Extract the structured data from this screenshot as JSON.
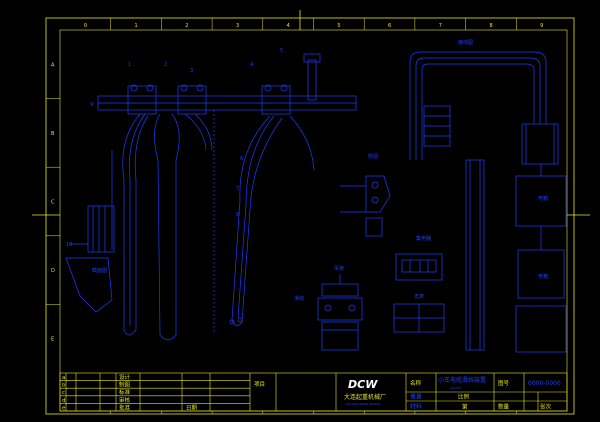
{
  "border": {
    "cols": [
      "0",
      "1",
      "2",
      "3",
      "4",
      "5",
      "6",
      "7",
      "8",
      "9"
    ],
    "rows": [
      "A",
      "B",
      "C",
      "D",
      "E"
    ]
  },
  "views": {
    "left_title": "截面图",
    "left_sub": "",
    "top_right_title": "接线图",
    "side_view_title": "侧视",
    "clamp_title": "吊架",
    "small_title": "滑线",
    "box_title": "集电器",
    "lower_box_title": "支架",
    "right_box_title": "电箱",
    "right_lower_title": "电箱"
  },
  "callouts": [
    "1",
    "2",
    "3",
    "4",
    "5",
    "6",
    "7",
    "8",
    "9",
    "10"
  ],
  "title_block": {
    "rows_left": [
      "设计",
      "制图",
      "标准",
      "审核",
      "批准"
    ],
    "row_marks": [
      "a",
      "b",
      "c",
      "d",
      "e"
    ],
    "date_label": "日期",
    "item_label": "项目",
    "company_logo": "DCW",
    "company_name": "大连起重机械厂",
    "company_en": "DALIAN CRANE WORKS",
    "name_label": "名称",
    "name_value": "小车电缆滑线装置",
    "name_sub": "XX-XXX",
    "material_label": "材料",
    "scale_label": "比例",
    "drawing_no_label": "图号",
    "drawing_no_value": "0000-0000",
    "qty_label": "数量",
    "sheet_label": "张次",
    "weight_label": "重量",
    "page_label": "第"
  },
  "colors": {
    "line": "#1e3cff",
    "frame": "#e8e820",
    "background": "#000000",
    "accent": "#ffffff"
  }
}
